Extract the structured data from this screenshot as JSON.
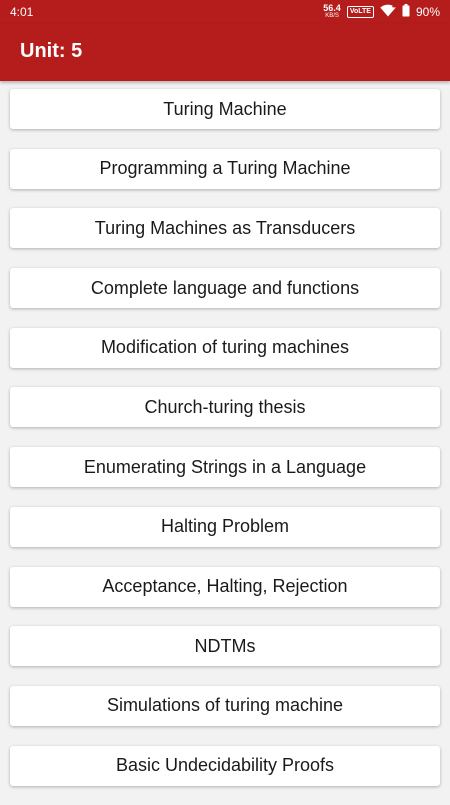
{
  "status_bar": {
    "time": "4:01",
    "net_speed_value": "56.4",
    "net_speed_unit": "KB/S",
    "volte": "VoLTE",
    "battery": "90%"
  },
  "app_bar": {
    "title": "Unit: 5"
  },
  "topics": [
    "Turing Machine",
    "Programming a Turing Machine",
    "Turing Machines as Transducers",
    "Complete language and functions",
    "Modification of turing machines",
    "Church-turing thesis",
    "Enumerating Strings in a Language",
    "Halting Problem",
    "Acceptance, Halting, Rejection",
    "NDTMs",
    "Simulations of turing machine",
    "Basic Undecidability Proofs"
  ],
  "colors": {
    "primary": "#b51c1c",
    "background": "#f2f2f2",
    "card": "#ffffff"
  },
  "icons": [
    "wifi-icon",
    "battery-icon"
  ]
}
